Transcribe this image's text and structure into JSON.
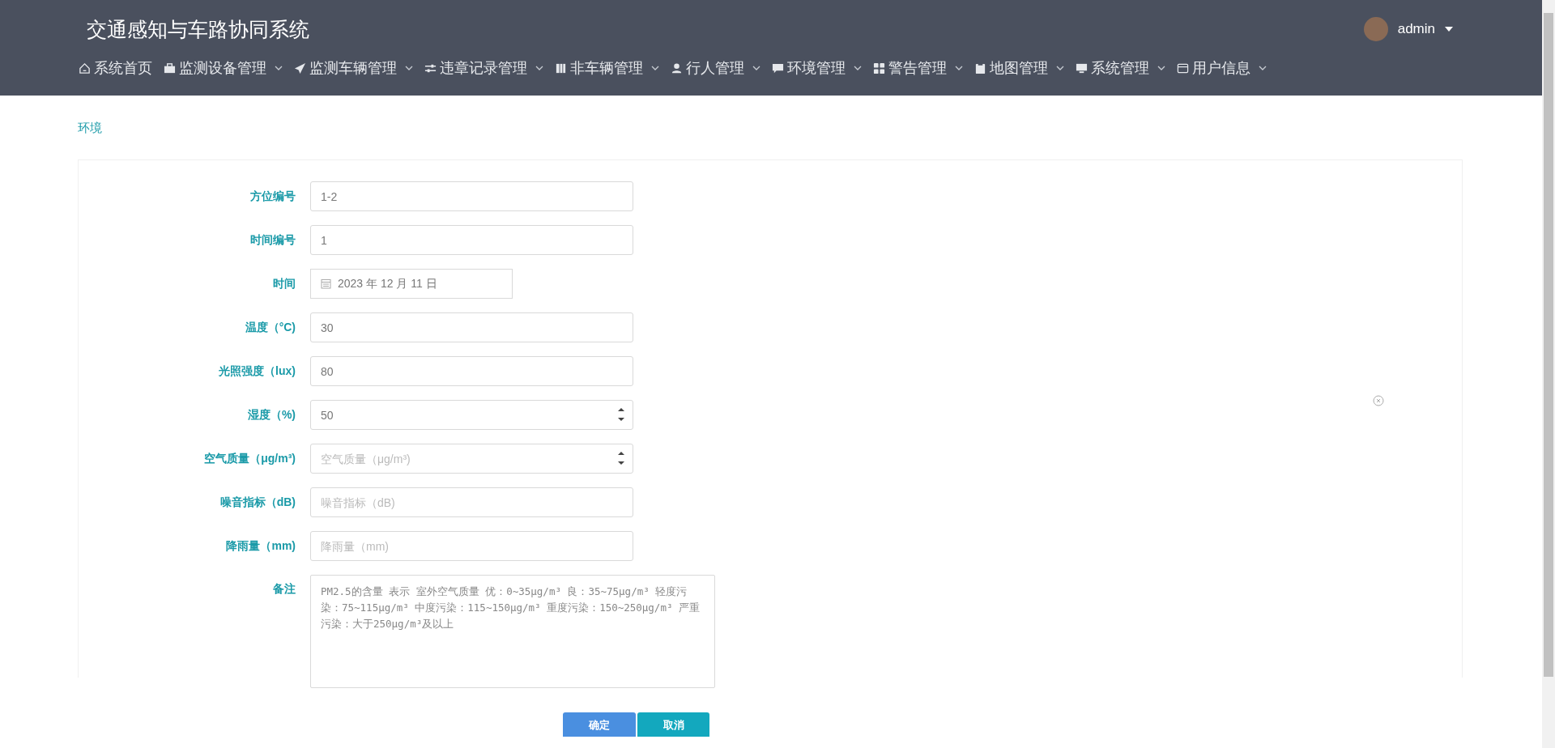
{
  "header": {
    "title": "交通感知与车路协同系统",
    "user": {
      "name": "admin"
    }
  },
  "nav": [
    {
      "label": "系统首页",
      "dropdown": false
    },
    {
      "label": "监测设备管理",
      "dropdown": true
    },
    {
      "label": "监测车辆管理",
      "dropdown": true
    },
    {
      "label": "违章记录管理",
      "dropdown": true
    },
    {
      "label": "非车辆管理",
      "dropdown": true
    },
    {
      "label": "行人管理",
      "dropdown": true
    },
    {
      "label": "环境管理",
      "dropdown": true
    },
    {
      "label": "警告管理",
      "dropdown": true
    },
    {
      "label": "地图管理",
      "dropdown": true
    },
    {
      "label": "系统管理",
      "dropdown": true
    },
    {
      "label": "用户信息",
      "dropdown": true
    }
  ],
  "breadcrumb": "环境",
  "form": {
    "fields": [
      {
        "kind": "text",
        "label": "方位编号",
        "value": "1-2"
      },
      {
        "kind": "text",
        "label": "时间编号",
        "value": "1"
      },
      {
        "kind": "date",
        "label": "时间",
        "value": "2023 年 12 月 11 日"
      },
      {
        "kind": "text",
        "label": "温度（°C)",
        "value": "30"
      },
      {
        "kind": "text",
        "label": "光照强度（lux)",
        "value": "80"
      },
      {
        "kind": "number",
        "label": "湿度（%)",
        "value": "50"
      },
      {
        "kind": "number",
        "label": "空气质量（μg/m³)",
        "placeholder": "空气质量（μg/m³)"
      },
      {
        "kind": "text",
        "label": "噪音指标（dB)",
        "placeholder": "噪音指标（dB)"
      },
      {
        "kind": "text",
        "label": "降雨量（mm)",
        "placeholder": "降雨量（mm)"
      },
      {
        "kind": "textarea",
        "label": "备注",
        "value": "PM2.5的含量 表示 室外空气质量  优：0~35μg/m³  良：35~75μg/m³  轻度污染：75~115μg/m³  中度污染：115~150μg/m³  重度污染：150~250μg/m³  严重污染：大于250μg/m³及以上"
      }
    ],
    "buttons": [
      {
        "kind": "primary",
        "label": "确定"
      },
      {
        "kind": "secondary",
        "label": "取消"
      }
    ]
  }
}
